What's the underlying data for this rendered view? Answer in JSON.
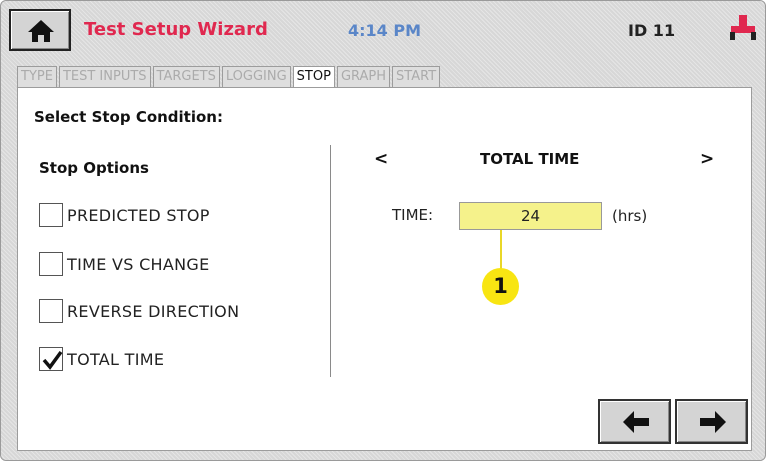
{
  "header": {
    "home_icon": "home-icon",
    "title": "Test Setup Wizard",
    "time": "4:14 PM",
    "device_id": "ID 11",
    "connection_icon": "connection-icon"
  },
  "tabs": [
    {
      "label": "TYPE",
      "active": false
    },
    {
      "label": "TEST INPUTS",
      "active": false
    },
    {
      "label": "TARGETS",
      "active": false
    },
    {
      "label": "LOGGING",
      "active": false
    },
    {
      "label": "STOP",
      "active": true
    },
    {
      "label": "GRAPH",
      "active": false
    },
    {
      "label": "START",
      "active": false
    }
  ],
  "main": {
    "section_title": "Select Stop Condition:",
    "options_title": "Stop Options",
    "options": [
      {
        "label": "PREDICTED STOP",
        "checked": false
      },
      {
        "label": "TIME VS CHANGE",
        "checked": false
      },
      {
        "label": "REVERSE DIRECTION",
        "checked": false
      },
      {
        "label": "TOTAL TIME",
        "checked": true
      }
    ],
    "stop_nav": {
      "prev": "<",
      "title": "TOTAL TIME",
      "next": ">"
    },
    "time_field": {
      "label": "TIME:",
      "value": "24",
      "unit": "(hrs)"
    },
    "callout": "1"
  },
  "footer": {
    "back_icon": "arrow-left-icon",
    "forward_icon": "arrow-right-icon"
  },
  "colors": {
    "title": "#e0284f",
    "clock": "#5a86c8",
    "input_fill": "#f5f28b",
    "callout": "#f8e512"
  }
}
